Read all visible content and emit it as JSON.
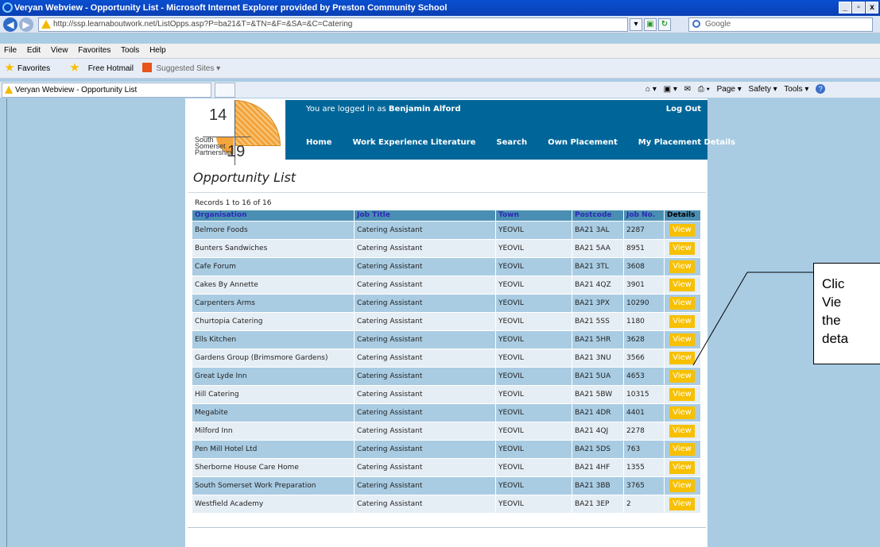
{
  "window": {
    "title": "Veryan Webview - Opportunity List - Microsoft Internet Explorer provided by Preston Community School",
    "min": "_",
    "max": "▫",
    "close": "x"
  },
  "address": {
    "url": "http://ssp.learnaboutwork.net/ListOpps.asp?P=ba21&T=&TN=&F=&SA=&C=Catering",
    "search_placeholder": "Google"
  },
  "menu": [
    "File",
    "Edit",
    "View",
    "Favorites",
    "Tools",
    "Help"
  ],
  "favorites": {
    "favorites_label": "Favorites",
    "hotmail": "Free Hotmail",
    "suggested": "Suggested Sites ▾"
  },
  "tab": {
    "label": "Veryan Webview - Opportunity List"
  },
  "commandbar": {
    "page": "Page ▾",
    "safety": "Safety ▾",
    "tools": "Tools ▾"
  },
  "logo": {
    "top_number": "14",
    "bottom_number": "19",
    "line1": "South",
    "line2": "Somerset",
    "line3": "Partnership"
  },
  "header": {
    "login_prefix": "You are logged in as ",
    "user": "Benjamin Alford",
    "logout": "Log Out",
    "nav": [
      "Home",
      "Work Experience Literature",
      "Search",
      "Own Placement",
      "My Placement Details"
    ]
  },
  "page_title": "Opportunity List",
  "records_text": "Records 1 to 16 of 16",
  "table": {
    "columns": [
      "Organisation",
      "Job Title",
      "Town",
      "Postcode",
      "Job No.",
      "Details"
    ],
    "view_label": "View",
    "rows": [
      [
        "Belmore Foods",
        "Catering Assistant",
        "YEOVIL",
        "BA21 3AL",
        "2287"
      ],
      [
        "Bunters Sandwiches",
        "Catering Assistant",
        "YEOVIL",
        "BA21 5AA",
        "8951"
      ],
      [
        "Cafe Forum",
        "Catering Assistant",
        "YEOVIL",
        "BA21 3TL",
        "3608"
      ],
      [
        "Cakes By Annette",
        "Catering Assistant",
        "YEOVIL",
        "BA21 4QZ",
        "3901"
      ],
      [
        "Carpenters Arms",
        "Catering Assistant",
        "YEOVIL",
        "BA21 3PX",
        "10290"
      ],
      [
        "Churtopia Catering",
        "Catering Assistant",
        "YEOVIL",
        "BA21 5SS",
        "1180"
      ],
      [
        "Ells Kitchen",
        "Catering Assistant",
        "YEOVIL",
        "BA21 5HR",
        "3628"
      ],
      [
        "Gardens Group (Brimsmore Gardens)",
        "Catering Assistant",
        "YEOVIL",
        "BA21 3NU",
        "3566"
      ],
      [
        "Great Lyde Inn",
        "Catering Assistant",
        "YEOVIL",
        "BA21 5UA",
        "4653"
      ],
      [
        "Hill Catering",
        "Catering Assistant",
        "YEOVIL",
        "BA21 5BW",
        "10315"
      ],
      [
        "Megabite",
        "Catering Assistant",
        "YEOVIL",
        "BA21 4DR",
        "4401"
      ],
      [
        "Milford Inn",
        "Catering Assistant",
        "YEOVIL",
        "BA21 4QJ",
        "2278"
      ],
      [
        "Pen Mill Hotel Ltd",
        "Catering Assistant",
        "YEOVIL",
        "BA21 5DS",
        "763"
      ],
      [
        "Sherborne House Care Home",
        "Catering Assistant",
        "YEOVIL",
        "BA21 4HF",
        "1355"
      ],
      [
        "South Somerset Work Preparation",
        "Catering Assistant",
        "YEOVIL",
        "BA21 3BB",
        "3765"
      ],
      [
        "Westfield Academy",
        "Catering Assistant",
        "YEOVIL",
        "BA21 3EP",
        "2"
      ]
    ]
  },
  "callout": {
    "lines": [
      "Clic",
      "Vie",
      "the",
      "deta"
    ]
  }
}
